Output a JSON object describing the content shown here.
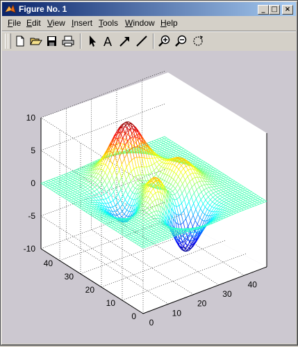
{
  "window": {
    "title": "Figure No. 1",
    "icon": "matlab-icon",
    "controls": {
      "minimize": "_",
      "maximize": "□",
      "close": "×"
    }
  },
  "menu": {
    "items": [
      {
        "mn": "F",
        "rest": "ile"
      },
      {
        "mn": "E",
        "rest": "dit"
      },
      {
        "mn": "V",
        "rest": "iew"
      },
      {
        "mn": "I",
        "rest": "nsert"
      },
      {
        "mn": "T",
        "rest": "ools"
      },
      {
        "mn": "W",
        "rest": "indow"
      },
      {
        "mn": "H",
        "rest": "elp"
      }
    ]
  },
  "toolbar": {
    "buttons": [
      "new-file-icon",
      "open-folder-icon",
      "save-icon",
      "print-icon",
      "select-arrow-icon",
      "insert-text-icon",
      "insert-arrow-icon",
      "insert-line-icon",
      "zoom-in-icon",
      "zoom-out-icon",
      "rotate-3d-icon"
    ],
    "text_tool_label": "A"
  },
  "chart_data": {
    "type": "surface",
    "title": "",
    "xlabel": "",
    "ylabel": "",
    "zlabel": "",
    "x_ticks": [
      "0",
      "10",
      "20",
      "30",
      "40"
    ],
    "y_ticks": [
      "0",
      "10",
      "20",
      "30",
      "40"
    ],
    "z_ticks": [
      "-10",
      "-5",
      "0",
      "5",
      "10"
    ],
    "xlim": [
      0,
      49
    ],
    "ylim": [
      0,
      49
    ],
    "zlim": [
      -10,
      10
    ],
    "grid": true,
    "colormap": "jet",
    "function": "peaks",
    "grid_size": 49,
    "z_max": 8.1,
    "z_min": -6.55
  }
}
